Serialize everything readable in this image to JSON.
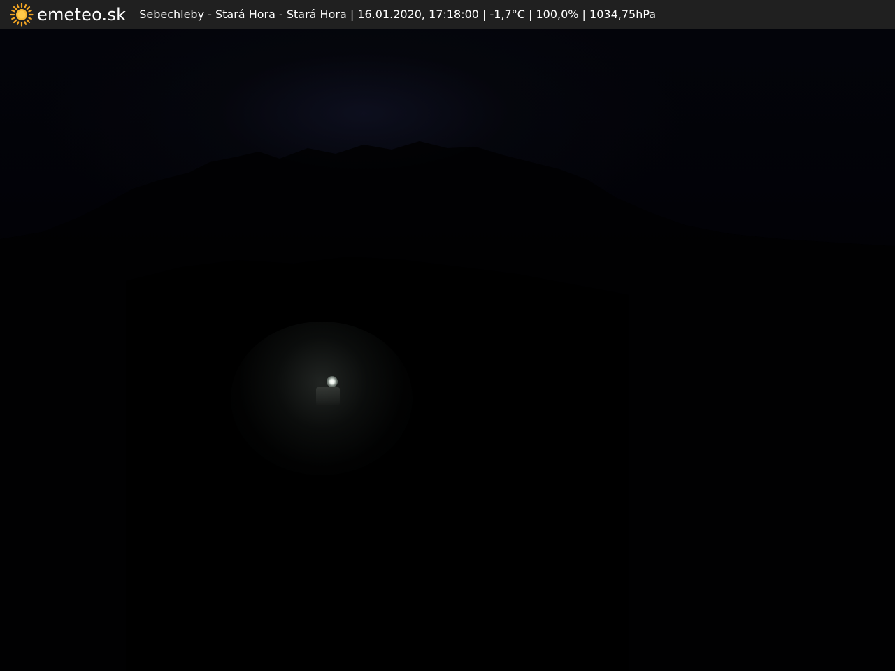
{
  "header": {
    "brand": "emeteo.sk",
    "caption": "Sebechleby - Stará Hora - Stará Hora | 16.01.2020, 17:18:00 | -1,7°C | 100,0% | 1034,75hPa",
    "icon": "sun-icon",
    "background_color": "#202020",
    "sun_color": "#f5a623"
  },
  "scene": {
    "description_icon": "webcam-image"
  }
}
